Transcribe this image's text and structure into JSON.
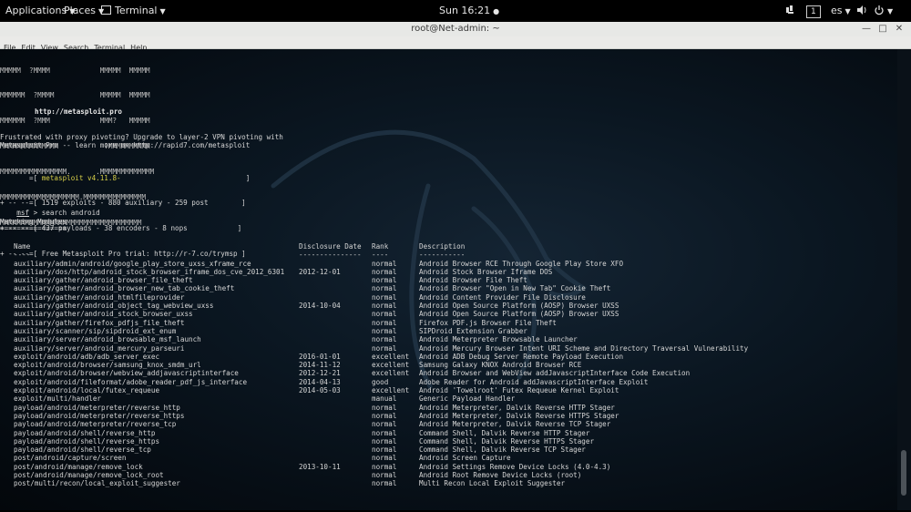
{
  "topbar": {
    "applications": "Applications",
    "places": "Places",
    "terminal": "Terminal",
    "clock": "Sun 16:21",
    "workspace": "1",
    "keyboard_layout": "es"
  },
  "window": {
    "title": "root@Net-admin: ~",
    "menu": [
      "File",
      "Edit",
      "View",
      "Search",
      "Terminal",
      "Help"
    ]
  },
  "terminal": {
    "banner_lines": [
      "MMMMM  ?MMMM            MMMMM  MMMMM",
      "MMMMMM  ?MMMM           MMMMM  MMMMM",
      "MMMMMM  ?MMM            MMM?   MMMMM",
      "MMMMMMMMMMMMMM           ?MMMMMMMMMM",
      "MMMMMMMMMMMMMMMM.      .MMMMMMMMMMMMM",
      "MMMMMMMMMMMMMMMMMMM.MMMMMMMMMMMMMMM",
      "MMMMMMMMMMMMMMMMMMMMMMMMMMMMMMMMMM"
    ],
    "banner_url": "http://metasploit.pro",
    "message_line1": "Frustrated with proxy pivoting? Upgrade to layer-2 VPN pivoting with",
    "message_line2": "Metasploit Pro -- learn more on http://rapid7.com/metasploit",
    "info_version_prefix": "       =[ ",
    "info_version": "metasploit v4.11.8-",
    "info_version_suffix": "                              ]",
    "info_line2": "+ -- --=[ 1519 exploits - 880 auxiliary - 259 post        ]",
    "info_line3": "+ -- --=[ 437 payloads - 38 encoders - 8 nops            ]",
    "info_line4": "+ -- --=[ Free Metasploit Pro trial: http://r-7.co/trymsp ]",
    "prompt": "msf",
    "command": " > search android",
    "matching_heading": "Matching Modules",
    "matching_rule": "================",
    "columns": {
      "name": "Name",
      "date": "Disclosure Date",
      "rank": "Rank",
      "description": "Description"
    },
    "column_underlines": {
      "name": "----",
      "date": "---------------",
      "rank": "----",
      "description": "-----------"
    },
    "modules": [
      {
        "name": "auxiliary/admin/android/google_play_store_uxss_xframe_rce",
        "date": "",
        "rank": "normal",
        "description": "Android Browser RCE Through Google Play Store XFO"
      },
      {
        "name": "auxiliary/dos/http/android_stock_browser_iframe_dos_cve_2012_6301",
        "date": "2012-12-01",
        "rank": "normal",
        "description": "Android Stock Browser Iframe DOS"
      },
      {
        "name": "auxiliary/gather/android_browser_file_theft",
        "date": "",
        "rank": "normal",
        "description": "Android Browser File Theft"
      },
      {
        "name": "auxiliary/gather/android_browser_new_tab_cookie_theft",
        "date": "",
        "rank": "normal",
        "description": "Android Browser \"Open in New Tab\" Cookie Theft"
      },
      {
        "name": "auxiliary/gather/android_htmlfileprovider",
        "date": "",
        "rank": "normal",
        "description": "Android Content Provider File Disclosure"
      },
      {
        "name": "auxiliary/gather/android_object_tag_webview_uxss",
        "date": "2014-10-04",
        "rank": "normal",
        "description": "Android Open Source Platform (AOSP) Browser UXSS"
      },
      {
        "name": "auxiliary/gather/android_stock_browser_uxss",
        "date": "",
        "rank": "normal",
        "description": "Android Open Source Platform (AOSP) Browser UXSS"
      },
      {
        "name": "auxiliary/gather/firefox_pdfjs_file_theft",
        "date": "",
        "rank": "normal",
        "description": "Firefox PDF.js Browser File Theft"
      },
      {
        "name": "auxiliary/scanner/sip/sipdroid_ext_enum",
        "date": "",
        "rank": "normal",
        "description": "SIPDroid Extension Grabber"
      },
      {
        "name": "auxiliary/server/android_browsable_msf_launch",
        "date": "",
        "rank": "normal",
        "description": "Android Meterpreter Browsable Launcher"
      },
      {
        "name": "auxiliary/server/android_mercury_parseuri",
        "date": "",
        "rank": "normal",
        "description": "Android Mercury Browser Intent URI Scheme and Directory Traversal Vulnerability"
      },
      {
        "name": "exploit/android/adb/adb_server_exec",
        "date": "2016-01-01",
        "rank": "excellent",
        "description": "Android ADB Debug Server Remote Payload Execution"
      },
      {
        "name": "exploit/android/browser/samsung_knox_smdm_url",
        "date": "2014-11-12",
        "rank": "excellent",
        "description": "Samsung Galaxy KNOX Android Browser RCE"
      },
      {
        "name": "exploit/android/browser/webview_addjavascriptinterface",
        "date": "2012-12-21",
        "rank": "excellent",
        "description": "Android Browser and WebView addJavascriptInterface Code Execution"
      },
      {
        "name": "exploit/android/fileformat/adobe_reader_pdf_js_interface",
        "date": "2014-04-13",
        "rank": "good",
        "description": "Adobe Reader for Android addJavascriptInterface Exploit"
      },
      {
        "name": "exploit/android/local/futex_requeue",
        "date": "2014-05-03",
        "rank": "excellent",
        "description": "Android 'Towelroot' Futex Requeue Kernel Exploit"
      },
      {
        "name": "exploit/multi/handler",
        "date": "",
        "rank": "manual",
        "description": "Generic Payload Handler"
      },
      {
        "name": "payload/android/meterpreter/reverse_http",
        "date": "",
        "rank": "normal",
        "description": "Android Meterpreter, Dalvik Reverse HTTP Stager"
      },
      {
        "name": "payload/android/meterpreter/reverse_https",
        "date": "",
        "rank": "normal",
        "description": "Android Meterpreter, Dalvik Reverse HTTPS Stager"
      },
      {
        "name": "payload/android/meterpreter/reverse_tcp",
        "date": "",
        "rank": "normal",
        "description": "Android Meterpreter, Dalvik Reverse TCP Stager"
      },
      {
        "name": "payload/android/shell/reverse_http",
        "date": "",
        "rank": "normal",
        "description": "Command Shell, Dalvik Reverse HTTP Stager"
      },
      {
        "name": "payload/android/shell/reverse_https",
        "date": "",
        "rank": "normal",
        "description": "Command Shell, Dalvik Reverse HTTPS Stager"
      },
      {
        "name": "payload/android/shell/reverse_tcp",
        "date": "",
        "rank": "normal",
        "description": "Command Shell, Dalvik Reverse TCP Stager"
      },
      {
        "name": "post/android/capture/screen",
        "date": "",
        "rank": "normal",
        "description": "Android Screen Capture"
      },
      {
        "name": "post/android/manage/remove_lock",
        "date": "2013-10-11",
        "rank": "normal",
        "description": "Android Settings Remove Device Locks (4.0-4.3)"
      },
      {
        "name": "post/android/manage/remove_lock_root",
        "date": "",
        "rank": "normal",
        "description": "Android Root Remove Device Locks (root)"
      },
      {
        "name": "post/multi/recon/local_exploit_suggester",
        "date": "",
        "rank": "normal",
        "description": "Multi Recon Local Exploit Suggester"
      }
    ]
  },
  "colors": {
    "terminal_bg": "#0b1722",
    "terminal_text": "#d6d6d6",
    "version_yellow": "#d8d048",
    "topbar_bg": "#000000"
  }
}
